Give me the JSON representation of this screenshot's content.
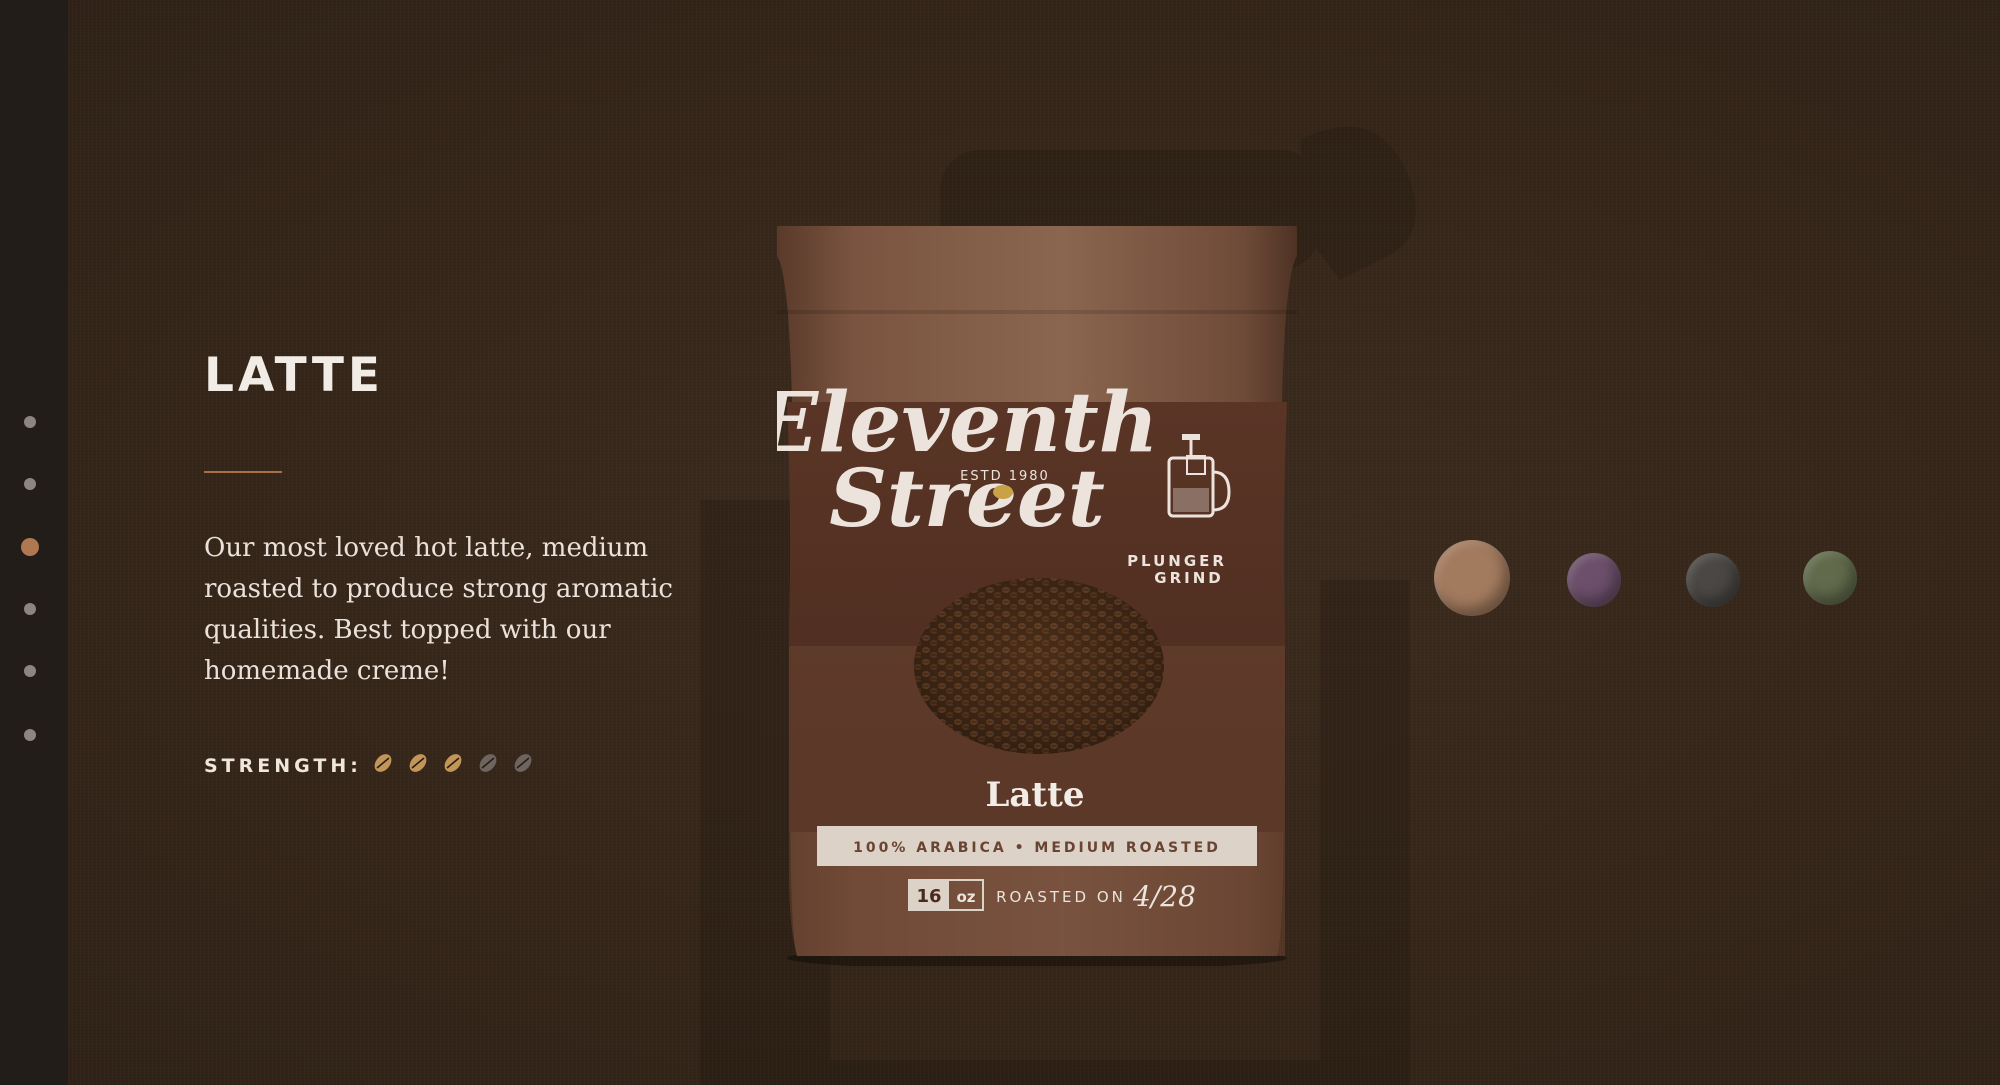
{
  "product": {
    "title": "LATTE",
    "description": "Our most loved hot latte, medium roasted to produce strong aromatic qualities. Best topped with our homemade creme!",
    "strength_label": "STRENGTH:",
    "strength_level": 3,
    "strength_max": 5
  },
  "nav": {
    "active_index": 2,
    "count": 6
  },
  "bag": {
    "brand_line1": "Eleventh",
    "brand_line2": "Street",
    "estd": "ESTD 1980",
    "grind_line1": "PLUNGER",
    "grind_line2": "GRIND",
    "flavor": "Latte",
    "band_text": "100% ARABICA • MEDIUM ROASTED",
    "weight_value": "16",
    "weight_unit": "oz",
    "roasted_label": "ROASTED ON",
    "roasted_date": "4/28"
  },
  "swatches": [
    {
      "name": "latte",
      "color": "#a27a5e",
      "selected": true
    },
    {
      "name": "purple",
      "color": "#6c4f6a",
      "selected": false
    },
    {
      "name": "gray",
      "color": "#4a4744",
      "selected": false
    },
    {
      "name": "green",
      "color": "#616a4b",
      "selected": false
    }
  ],
  "colors": {
    "background": "#3a2a1f",
    "rail": "#231d1a",
    "accent": "#b07850",
    "strength_on": "#c29658",
    "strength_off": "#6e6560"
  }
}
